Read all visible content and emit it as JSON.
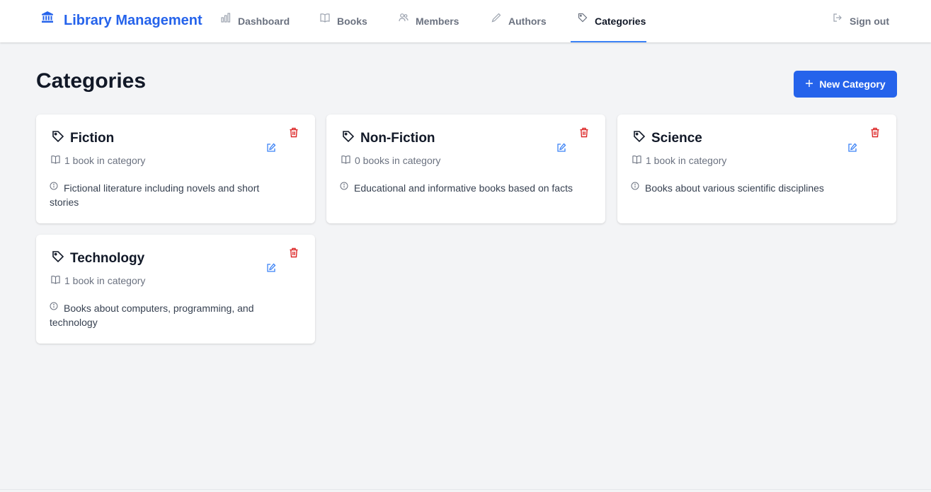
{
  "app": {
    "title": "Library Management",
    "logo_icon": "library-building-icon",
    "brand_color": "#2563eb"
  },
  "nav": {
    "items": [
      {
        "label": "Dashboard",
        "icon": "bar-chart-icon"
      },
      {
        "label": "Books",
        "icon": "book-open-icon"
      },
      {
        "label": "Members",
        "icon": "users-icon"
      },
      {
        "label": "Authors",
        "icon": "pencil-icon"
      },
      {
        "label": "Categories",
        "icon": "tag-icon",
        "active": true
      }
    ],
    "sign_out": {
      "label": "Sign out",
      "icon": "sign-out-icon"
    }
  },
  "page": {
    "title": "Categories",
    "new_button": {
      "label": "New Category",
      "icon": "plus-icon"
    }
  },
  "categories": [
    {
      "name": "Fiction",
      "count": "1 book in category",
      "description": "Fictional literature including novels and short stories"
    },
    {
      "name": "Non-Fiction",
      "count": "0 books in category",
      "description": "Educational and informative books based on facts"
    },
    {
      "name": "Science",
      "count": "1 book in category",
      "description": "Books about various scientific disciplines"
    },
    {
      "name": "Technology",
      "count": "1 book in category",
      "description": "Books about computers, programming, and technology"
    }
  ],
  "colors": {
    "accent": "#2563eb",
    "delete": "#dc2626",
    "edit": "#3b82f6",
    "background": "#f3f4f6"
  }
}
